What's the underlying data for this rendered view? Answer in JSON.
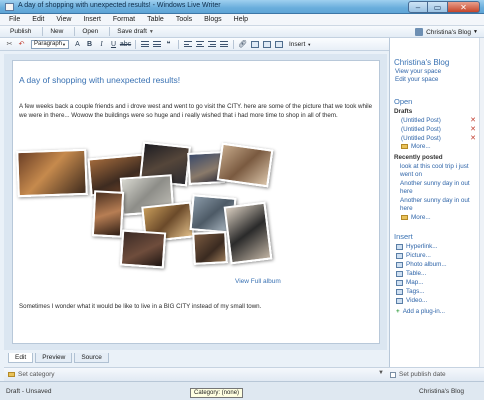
{
  "window": {
    "title": "A day of shopping with unexpected results! - Windows Live Writer",
    "min": "–",
    "max": "▭",
    "close": "✕"
  },
  "menu": [
    "File",
    "Edit",
    "View",
    "Insert",
    "Format",
    "Table",
    "Tools",
    "Blogs",
    "Help"
  ],
  "actionbar": {
    "publish": "Publish",
    "new": "New",
    "open": "Open",
    "save_draft": "Save draft",
    "blog": "Christina's Blog"
  },
  "formatbar": {
    "paragraph": "Paragraph",
    "insert": "Insert"
  },
  "post": {
    "title": "A day of shopping with unexpected results!",
    "paragraph1": "A few weeks back a couple friends and i drove west and went to go visit the CITY.  here are some of the picture that we took while we were in there... Wowow the buildings were so huge and i really wished that i had more time to shop in all of them.",
    "view_album": "View Full album",
    "paragraph2": "Sometimes I wonder what it would be like to live in a BIG CITY instead of my small town."
  },
  "tabs": [
    "Edit",
    "Preview",
    "Source"
  ],
  "properties": {
    "category_placeholder": "Set category",
    "publish_date": "Set publish date"
  },
  "status": {
    "left": "Draft - Unsaved",
    "right": "Christina's Blog",
    "tooltip": "Category: (none)"
  },
  "sidebar": {
    "blog_name": "Christina's Blog",
    "view_space": "View your space",
    "edit_space": "Edit your space",
    "open_head": "Open",
    "drafts_head": "Drafts",
    "drafts": [
      "(Untitled Post)",
      "(Untitled Post)",
      "(Untitled Post)"
    ],
    "drafts_more": "More...",
    "recent_head": "Recently posted",
    "recent": [
      "look at this cool trip i just went on",
      "Another sunny day in out here",
      "Another sunny day in out here"
    ],
    "recent_more": "More...",
    "insert_head": "Insert",
    "insert_items": [
      "Hyperlink...",
      "Picture...",
      "Photo album...",
      "Table...",
      "Map...",
      "Tags...",
      "Video...",
      "Add a plug-in..."
    ]
  }
}
